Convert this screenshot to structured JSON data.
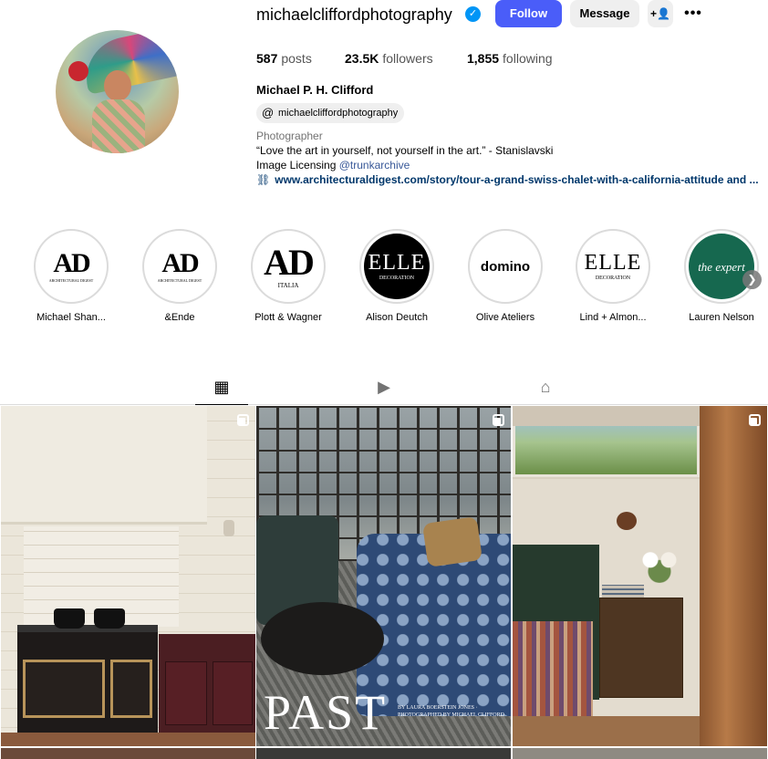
{
  "profile": {
    "username": "michaelcliffordphotography",
    "verified_symbol": "✓",
    "buttons": {
      "follow": "Follow",
      "message": "Message",
      "add_user": "+👤",
      "more": "•••"
    },
    "stats": {
      "posts_count": "587",
      "posts_label": "posts",
      "followers_count": "23.5K",
      "followers_label": "followers",
      "following_count": "1,855",
      "following_label": "following"
    },
    "full_name": "Michael P. H. Clifford",
    "threads_handle": "michaelcliffordphotography",
    "category": "Photographer",
    "bio_quote": "“Love the art in yourself, not yourself in the art.” - Stanislavski",
    "bio_licensing_prefix": "Image Licensing ",
    "bio_licensing_mention": "@trunkarchive",
    "website": "www.architecturaldigest.com/story/tour-a-grand-swiss-chalet-with-a-california-attitude and ..."
  },
  "highlights": [
    {
      "label": "Michael Shan...",
      "logo": "AD",
      "logo_sub": "ARCHITECTURAL DIGEST"
    },
    {
      "label": "&Ende",
      "logo": "AD",
      "logo_sub": "ARCHITECTURAL DIGEST"
    },
    {
      "label": "Plott & Wagner",
      "logo": "AD",
      "logo_sub": "ITALIA"
    },
    {
      "label": "Alison Deutch",
      "logo": "ELLE",
      "logo_sub": "DECORATION"
    },
    {
      "label": "Olive Ateliers",
      "logo": "domino",
      "logo_sub": ""
    },
    {
      "label": "Lind + Almon...",
      "logo": "ELLE",
      "logo_sub": "DECORATION"
    },
    {
      "label": "Lauren Nelson",
      "logo": "the expert",
      "logo_sub": ""
    }
  ],
  "tabs": [
    {
      "name": "posts",
      "icon": "grid-icon",
      "glyph": "▦"
    },
    {
      "name": "reels",
      "icon": "reels-icon",
      "glyph": "▶"
    },
    {
      "name": "tagged",
      "icon": "tagged-icon",
      "glyph": "⌂"
    }
  ],
  "posts": [
    {
      "caption_title": "",
      "caption_credit": ""
    },
    {
      "caption_title": "PAST",
      "caption_credit": "BY LAURA BOERSTEIN JONES · PHOTOGRAPHED BY MICHAEL CLIFFORD"
    },
    {
      "caption_title": "",
      "caption_credit": ""
    }
  ],
  "colors": {
    "follow_button": "#4a5df9",
    "secondary_button": "#efefef",
    "verified_badge": "#0095f6",
    "link": "#00376b",
    "mention": "#385898"
  }
}
